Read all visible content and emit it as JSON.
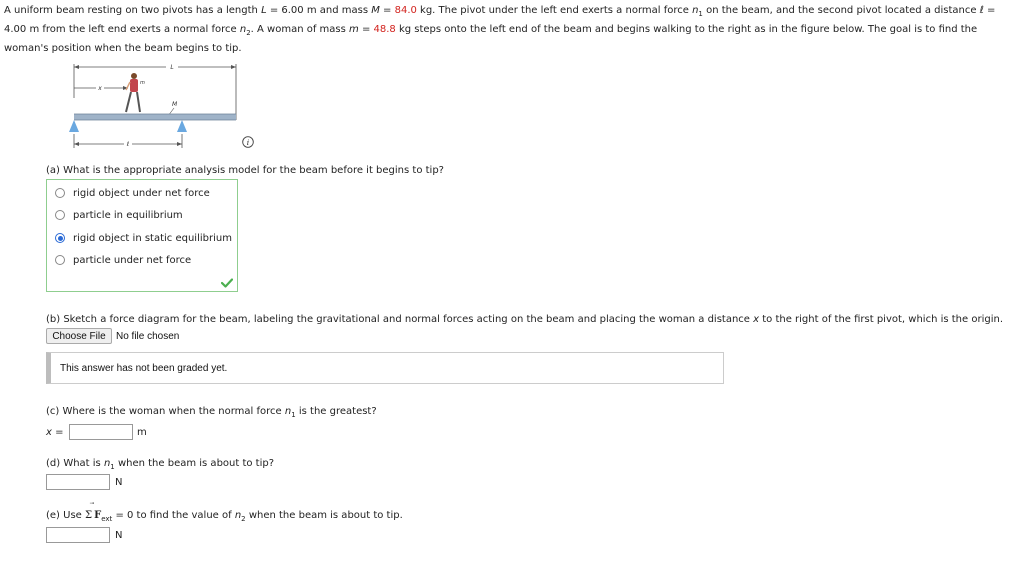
{
  "problem": {
    "p1": "A uniform beam resting on two pivots has a length ",
    "L_sym": "L",
    "p2": " = 6.00 m and mass ",
    "M_sym": "M",
    "p3": " = ",
    "M_val": "84.0",
    "p4": " kg. The pivot under the left end exerts a normal force ",
    "n_sym": "n",
    "sub1": "1",
    "p5": " on the beam, and the second pivot located a distance ℓ =",
    "p6": "4.00 m from the left end exerts a normal force ",
    "sub2": "2",
    "p7": ". A woman of mass ",
    "m_sym": "m",
    "p8": " = ",
    "m_val": "48.8",
    "p9": " kg steps onto the left end of the beam and begins walking to the right as in the figure below. The goal is to find the",
    "p10": "woman's position when the beam begins to tip."
  },
  "figure": {
    "label_L": "L",
    "label_x": "x",
    "label_m": "m",
    "label_M": "M",
    "label_ell": "ℓ",
    "info_icon": "i"
  },
  "part_a": {
    "question": "(a) What is the appropriate analysis model for the beam before it begins to tip?",
    "options": [
      "rigid object under net force",
      "particle in equilibrium",
      "rigid object in static equilibrium",
      "particle under net force"
    ],
    "selected_index": 2,
    "status": "correct"
  },
  "part_b": {
    "question_pre": "(b) Sketch a force diagram for the beam, labeling the gravitational and normal forces acting on the beam and placing the woman a distance ",
    "x_sym": "x",
    "question_post": " to the right of the first pivot, which is the origin.",
    "file_button": "Choose File",
    "file_status": "No file chosen",
    "graded_note": "This answer has not been graded yet."
  },
  "part_c": {
    "question_pre": "(c) Where is the woman when the normal force ",
    "n_sym": "n",
    "sub": "1",
    "question_post": " is the greatest?",
    "var_label": "x",
    "eq": " =",
    "value": "",
    "unit": "m"
  },
  "part_d": {
    "question_pre": "(d) What is ",
    "n_sym": "n",
    "sub": "1",
    "question_post": " when the beam is about to tip?",
    "value": "",
    "unit": "N"
  },
  "part_e": {
    "question_pre": "(e) Use ",
    "sigma": "Σ",
    "F": "F",
    "arrow": "⃗",
    "ext": "ext",
    "question_mid": " = 0 to find the value of ",
    "n_sym": "n",
    "sub": "2",
    "question_post": " when the beam is about to tip.",
    "value": "",
    "unit": "N"
  },
  "colors": {
    "accent_red": "#d2231e",
    "correct_border": "#8fce8f",
    "radio_selected": "#2a6ad6",
    "check_green": "#4caf50"
  }
}
